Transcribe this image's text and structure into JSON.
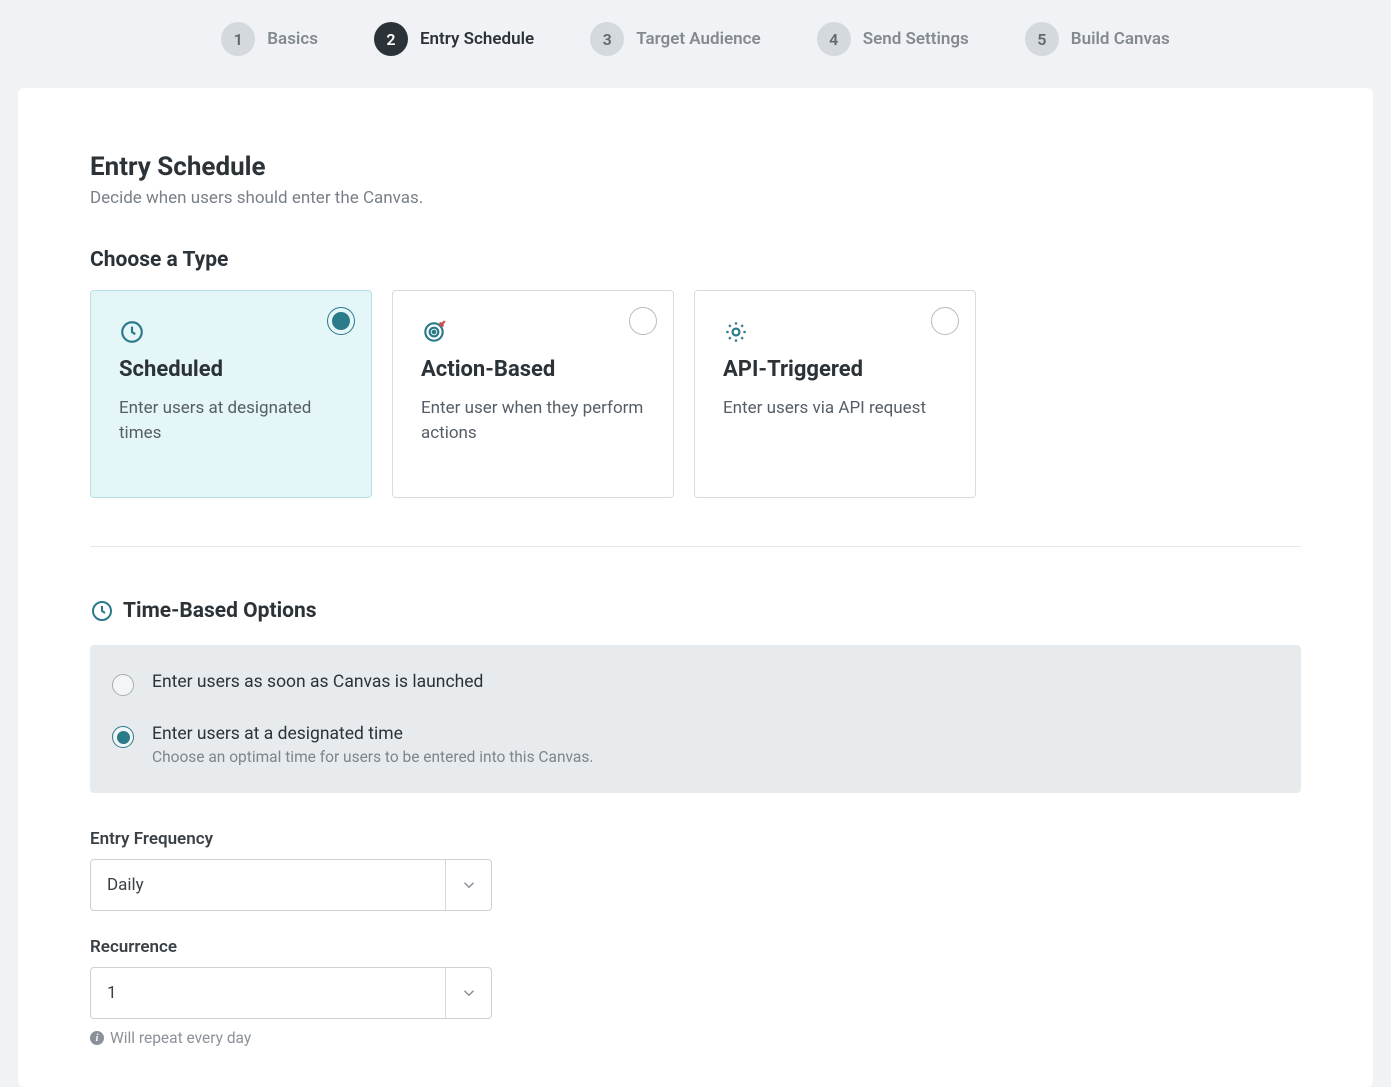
{
  "steps": [
    {
      "num": "1",
      "label": "Basics"
    },
    {
      "num": "2",
      "label": "Entry Schedule"
    },
    {
      "num": "3",
      "label": "Target Audience"
    },
    {
      "num": "4",
      "label": "Send Settings"
    },
    {
      "num": "5",
      "label": "Build Canvas"
    }
  ],
  "active_step_index": 1,
  "page": {
    "title": "Entry Schedule",
    "subtitle": "Decide when users should enter the Canvas."
  },
  "choose_type": {
    "title": "Choose a Type",
    "selected_index": 0,
    "cards": [
      {
        "name": "Scheduled",
        "desc": "Enter users at designated times",
        "icon": "clock-icon"
      },
      {
        "name": "Action-Based",
        "desc": "Enter user when they perform actions",
        "icon": "target-icon"
      },
      {
        "name": "API-Triggered",
        "desc": "Enter users via API request",
        "icon": "gear-icon"
      }
    ]
  },
  "time_options": {
    "title": "Time-Based Options",
    "selected_index": 1,
    "items": [
      {
        "label": "Enter users as soon as Canvas is launched"
      },
      {
        "label": "Enter users at a designated time",
        "help": "Choose an optimal time for users to be entered into this Canvas."
      }
    ]
  },
  "entry_frequency": {
    "label": "Entry Frequency",
    "value": "Daily"
  },
  "recurrence": {
    "label": "Recurrence",
    "value": "1",
    "helper": "Will repeat every day"
  }
}
